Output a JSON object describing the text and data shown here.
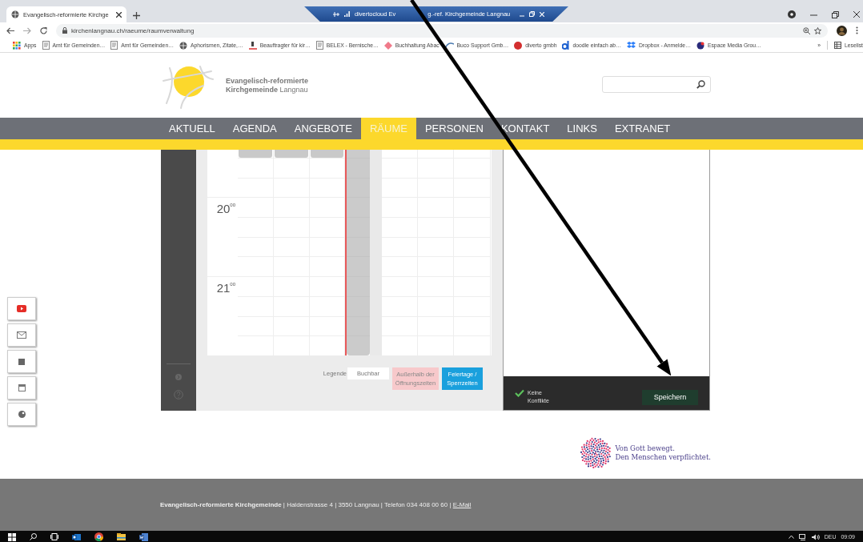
{
  "browser": {
    "tabs": [
      {
        "title": "Evangelisch-reformierte Kirchge",
        "selected": true
      }
    ],
    "remote_bar": {
      "title_parts": [
        "divertocloud Ev",
        "g.-ref. Kirchgemeinde Langnau"
      ]
    },
    "url": "kirchenlangnau.ch/raeume/raumverwaltung",
    "bookmarks": [
      {
        "label": "Apps",
        "kind": "apps"
      },
      {
        "label": "Amt für Gemeinden…",
        "kind": "doc"
      },
      {
        "label": "Amt für Gemeinden…",
        "kind": "doc"
      },
      {
        "label": "Aphorismen, Zitate,…",
        "kind": "globe"
      },
      {
        "label": "Beauftragter für kir…",
        "kind": "flag"
      },
      {
        "label": "BELEX - Bernische…",
        "kind": "doc"
      },
      {
        "label": "Buchhaltung Abac",
        "kind": "diamond"
      },
      {
        "label": "Buco Support Gmb…",
        "kind": "wave"
      },
      {
        "label": "diverto gmbh",
        "kind": "ball"
      },
      {
        "label": "doodle einfach ab…",
        "kind": "d"
      },
      {
        "label": "Dropbox - Anmelde…",
        "kind": "boxes"
      },
      {
        "label": "Espace Media Grou…",
        "kind": "dot"
      }
    ],
    "more": "»",
    "reading_list": "Leselist"
  },
  "site": {
    "logo_lines": [
      "Evangelisch-reformierte",
      "**Kirchgemeinde** Langnau"
    ],
    "nav": [
      {
        "label": "AKTUELL",
        "selected": false
      },
      {
        "label": "AGENDA",
        "selected": false
      },
      {
        "label": "ANGEBOTE",
        "selected": false
      },
      {
        "label": "RÄUME",
        "selected": true
      },
      {
        "label": "PERSONEN",
        "selected": false
      },
      {
        "label": "KONTAKT",
        "selected": false
      },
      {
        "label": "LINKS",
        "selected": false
      },
      {
        "label": "EXTRANET",
        "selected": false
      }
    ],
    "calendar": {
      "time_labels": [
        "20$^{00}$",
        "21$^{00}$"
      ],
      "legend_title": "Legende",
      "legend": [
        {
          "label": "Buchbar",
          "kind": "free"
        },
        {
          "label": "Außerhalb der Öffnungszeiten",
          "kind": "closed"
        },
        {
          "label": "Feiertage / Sperrzeiten",
          "kind": "holiday"
        }
      ]
    },
    "panel": {
      "status": "Keine Konflikte",
      "button": "Speichern"
    },
    "tagline": [
      "Von Gott bewegt.",
      "Den Menschen verpflichtet."
    ],
    "footer": {
      "text": "**Evangelisch-reformierte Kirchgemeinde** | Haldenstrasse 4 | 3550 Langnau | Telefon 034 408 00 60 | ",
      "link": "E-Mail"
    }
  },
  "taskbar": {
    "language": "DEU",
    "time": "09:09"
  }
}
